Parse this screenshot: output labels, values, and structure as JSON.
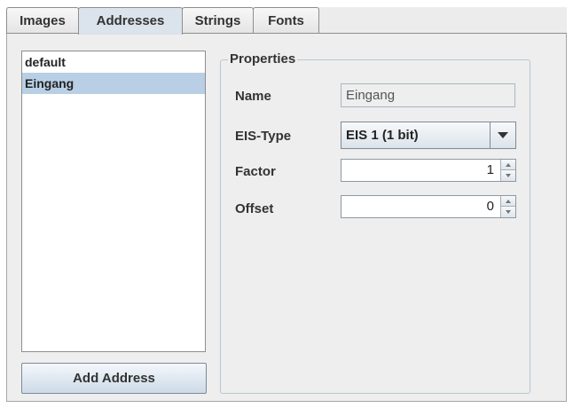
{
  "tabs": [
    {
      "label": "Images"
    },
    {
      "label": "Addresses"
    },
    {
      "label": "Strings"
    },
    {
      "label": "Fonts"
    }
  ],
  "active_tab": "Addresses",
  "address_list": {
    "items": [
      {
        "label": "default",
        "selected": false
      },
      {
        "label": "Eingang",
        "selected": true
      }
    ]
  },
  "add_button_label": "Add Address",
  "properties": {
    "title": "Properties",
    "name_label": "Name",
    "name_value": "Eingang",
    "eis_type_label": "EIS-Type",
    "eis_type_value": "EIS 1 (1 bit)",
    "factor_label": "Factor",
    "factor_value": "1",
    "offset_label": "Offset",
    "offset_value": "0"
  },
  "icons": {
    "combo_arrow": "chevron-down-icon",
    "spin_up": "spin-up-icon",
    "spin_down": "spin-down-icon"
  },
  "colors": {
    "selection": "#b8cfe5",
    "active_tab": "#dbe3ec"
  }
}
